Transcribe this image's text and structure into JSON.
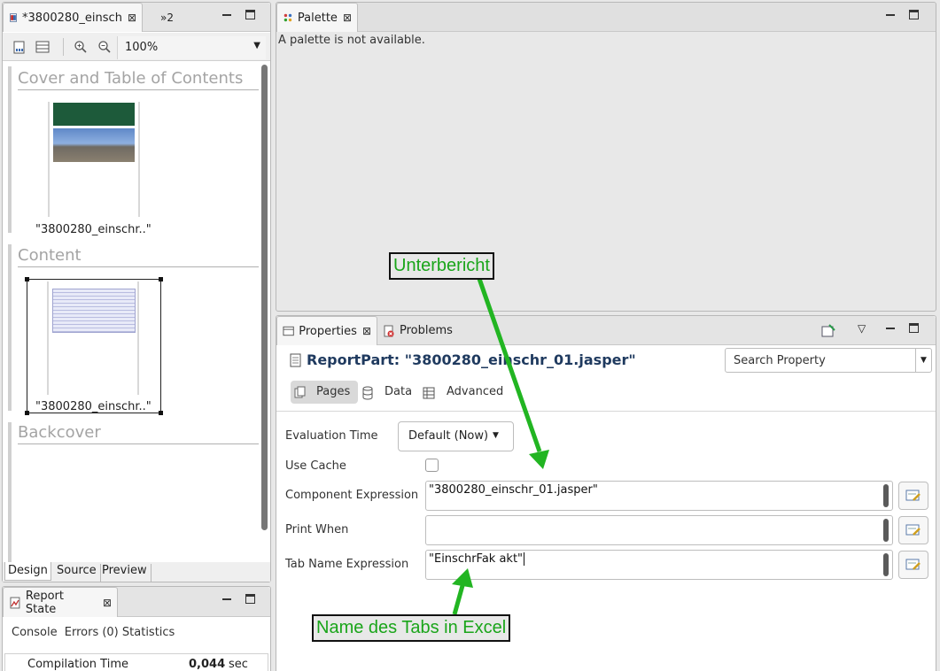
{
  "editor": {
    "tab_title": "*3800280_einsch",
    "overflow_label": "»2",
    "zoom_value": "100%",
    "sections": [
      {
        "title": "Cover and Table of Contents",
        "thumb_label": "\"3800280_einschr..\""
      },
      {
        "title": "Content",
        "thumb_label": "\"3800280_einschr..\""
      },
      {
        "title": "Backcover"
      }
    ],
    "bottom_tabs": [
      "Design",
      "Source",
      "Preview"
    ]
  },
  "palette": {
    "tab_title": "Palette",
    "message": "A palette is not available."
  },
  "report_state": {
    "tab_title": "Report State",
    "subtabs": [
      "Console",
      "Errors (0)",
      "Statistics"
    ],
    "row_label": "Compilation Time",
    "row_value": "0,044",
    "row_unit": "sec"
  },
  "properties": {
    "tabs": [
      "Properties",
      "Problems"
    ],
    "heading": "ReportPart: \"3800280_einschr_01.jasper\"",
    "search_placeholder": "Search Property",
    "subtabs": [
      "Pages",
      "Data",
      "Advanced"
    ],
    "fields": {
      "evaluation_time_label": "Evaluation Time",
      "evaluation_time_value": "Default (Now)",
      "use_cache_label": "Use Cache",
      "component_expression_label": "Component Expression",
      "component_expression_value": "\"3800280_einschr_01.jasper\"",
      "print_when_label": "Print When",
      "print_when_value": "",
      "tab_name_label": "Tab Name Expression",
      "tab_name_value": "\"EinschrFak akt\""
    }
  },
  "annotations": {
    "unterbericht": "Unterbericht",
    "tab_name": "Name des Tabs in Excel"
  },
  "colors": {
    "annotation_text": "#1aa51a",
    "annotation_arrow": "#22b522",
    "heading_text": "#1f3a5f"
  }
}
